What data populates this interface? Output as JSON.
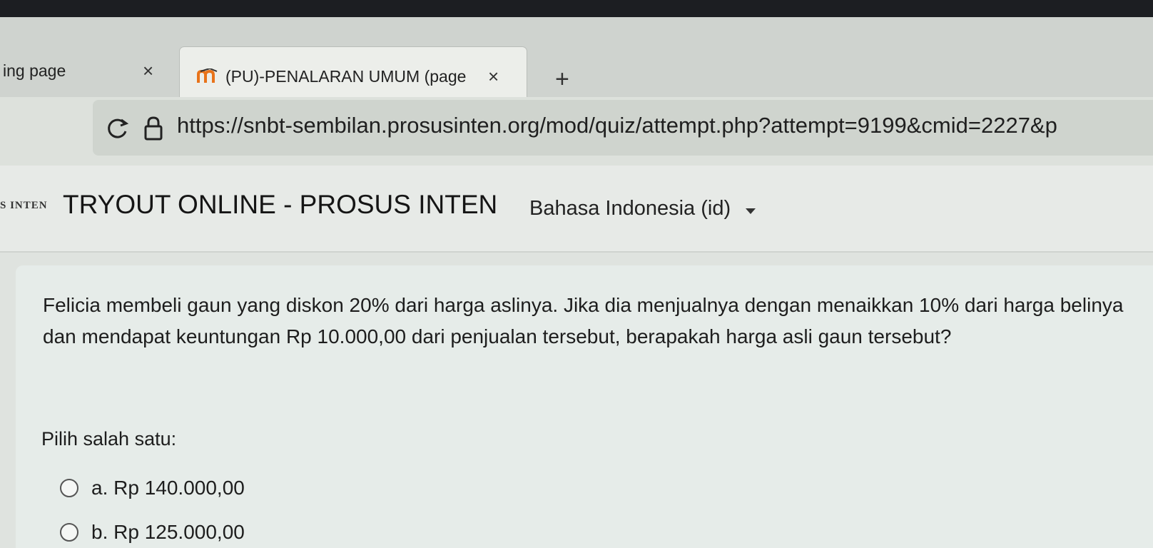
{
  "browser": {
    "tabs": [
      {
        "label": "ing page",
        "active": false
      },
      {
        "label": "(PU)-PENALARAN UMUM (page",
        "active": true
      }
    ],
    "close_glyph": "×",
    "new_tab_glyph": "+",
    "url": "https://snbt-sembilan.prosusinten.org/mod/quiz/attempt.php?attempt=9199&cmid=2227&p",
    "icons": [
      "reload-icon",
      "lock-icon",
      "moodle-favicon",
      "close-icon",
      "plus-icon"
    ]
  },
  "header": {
    "logo_text": "S INTEN",
    "site_title": "TRYOUT ONLINE - PROSUS INTEN",
    "language": "Bahasa Indonesia (id)"
  },
  "question": {
    "text": "Felicia membeli gaun yang diskon 20% dari harga aslinya. Jika dia menjualnya dengan menaikkan 10% dari harga belinya dan mendapat keuntungan Rp 10.000,00 dari penjualan tersebut, berapakah harga asli gaun tersebut?",
    "prompt": "Pilih salah satu:",
    "options": [
      {
        "label": "a. Rp 140.000,00",
        "selected": false
      },
      {
        "label": "b. Rp 125.000,00",
        "selected": false
      }
    ]
  },
  "colors": {
    "accent": "#1c1e22",
    "card_bg": "#e6ece9",
    "header_bg": "#e7eae7"
  }
}
